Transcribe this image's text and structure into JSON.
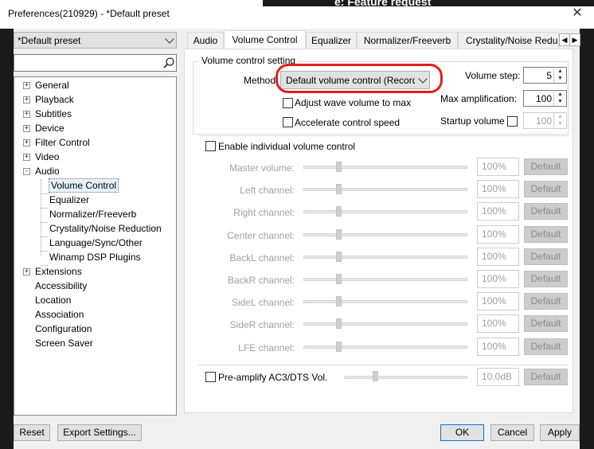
{
  "window": {
    "title": "Preferences(210929) - *Default preset",
    "background_text": "e: Feature request"
  },
  "preset": {
    "value": "*Default preset"
  },
  "search": {
    "placeholder": ""
  },
  "tree": [
    {
      "label": "General",
      "expander": "+"
    },
    {
      "label": "Playback",
      "expander": "+"
    },
    {
      "label": "Subtitles",
      "expander": "+"
    },
    {
      "label": "Device",
      "expander": "+"
    },
    {
      "label": "Filter Control",
      "expander": "+"
    },
    {
      "label": "Video",
      "expander": "+"
    },
    {
      "label": "Audio",
      "expander": "-"
    },
    {
      "label": "Volume Control",
      "child": true,
      "selected": true
    },
    {
      "label": "Equalizer",
      "child": true
    },
    {
      "label": "Normalizer/Freeverb",
      "child": true
    },
    {
      "label": "Crystality/Noise Reduction",
      "child": true
    },
    {
      "label": "Language/Sync/Other",
      "child": true
    },
    {
      "label": "Winamp DSP Plugins",
      "child": true
    },
    {
      "label": "Extensions",
      "expander": "+"
    },
    {
      "label": "Accessibility"
    },
    {
      "label": "Location"
    },
    {
      "label": "Association"
    },
    {
      "label": "Configuration"
    },
    {
      "label": "Screen Saver"
    }
  ],
  "tabs": [
    "Audio",
    "Volume Control",
    "Equalizer",
    "Normalizer/Freeverb",
    "Crystality/Noise Reduction"
  ],
  "active_tab": "Volume Control",
  "volume_setting": {
    "group_label": "Volume control setting",
    "method_label": "Method",
    "method_value": "Default volume control (Recording)",
    "adjust_wave_label": "Adjust wave volume to max",
    "accelerate_label": "Accelerate control speed",
    "volume_step_label": "Volume step:",
    "volume_step_value": "5",
    "max_amp_label": "Max amplification:",
    "max_amp_value": "100",
    "startup_label": "Startup volume",
    "startup_value": "100"
  },
  "individual": {
    "enable_label": "Enable individual volume control",
    "default_label": "Default",
    "channels": [
      {
        "label": "Master volume:",
        "value": "100%",
        "level": 0.2
      },
      {
        "label": "Left channel:",
        "value": "100%",
        "level": 0.2
      },
      {
        "label": "Right channel:",
        "value": "100%",
        "level": 0.2
      },
      {
        "label": "Center channel:",
        "value": "100%",
        "level": 0.2
      },
      {
        "label": "BackL channel:",
        "value": "100%",
        "level": 0.2
      },
      {
        "label": "BackR channel:",
        "value": "100%",
        "level": 0.2
      },
      {
        "label": "SideL channel:",
        "value": "100%",
        "level": 0.2
      },
      {
        "label": "SideR channel:",
        "value": "100%",
        "level": 0.2
      },
      {
        "label": "LFE channel:",
        "value": "100%",
        "level": 0.2
      }
    ]
  },
  "preamp": {
    "label": "Pre-amplify AC3/DTS Vol.",
    "value": "10.0dB",
    "level": 0.1
  },
  "buttons": {
    "reset": "Reset",
    "export": "Export Settings...",
    "ok": "OK",
    "cancel": "Cancel",
    "apply": "Apply"
  },
  "icons": {
    "close": "close-icon",
    "search": "search-icon"
  },
  "colors": {
    "annotation": "#e21e1e",
    "accent": "#0078d7"
  }
}
